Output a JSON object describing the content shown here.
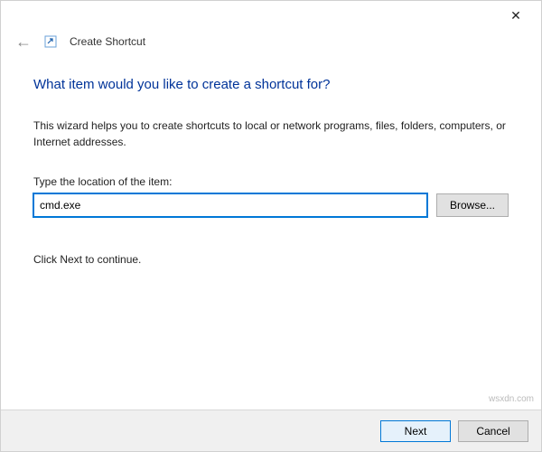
{
  "titlebar": {
    "close_glyph": "✕"
  },
  "header": {
    "back_glyph": "←",
    "title": "Create Shortcut"
  },
  "main": {
    "heading": "What item would you like to create a shortcut for?",
    "description": "This wizard helps you to create shortcuts to local or network programs, files, folders, computers, or Internet addresses.",
    "location_label": "Type the location of the item:",
    "location_value": "cmd.exe",
    "browse_label": "Browse...",
    "hint": "Click Next to continue."
  },
  "footer": {
    "next_label": "Next",
    "cancel_label": "Cancel"
  },
  "watermark": "wsxdn.com"
}
